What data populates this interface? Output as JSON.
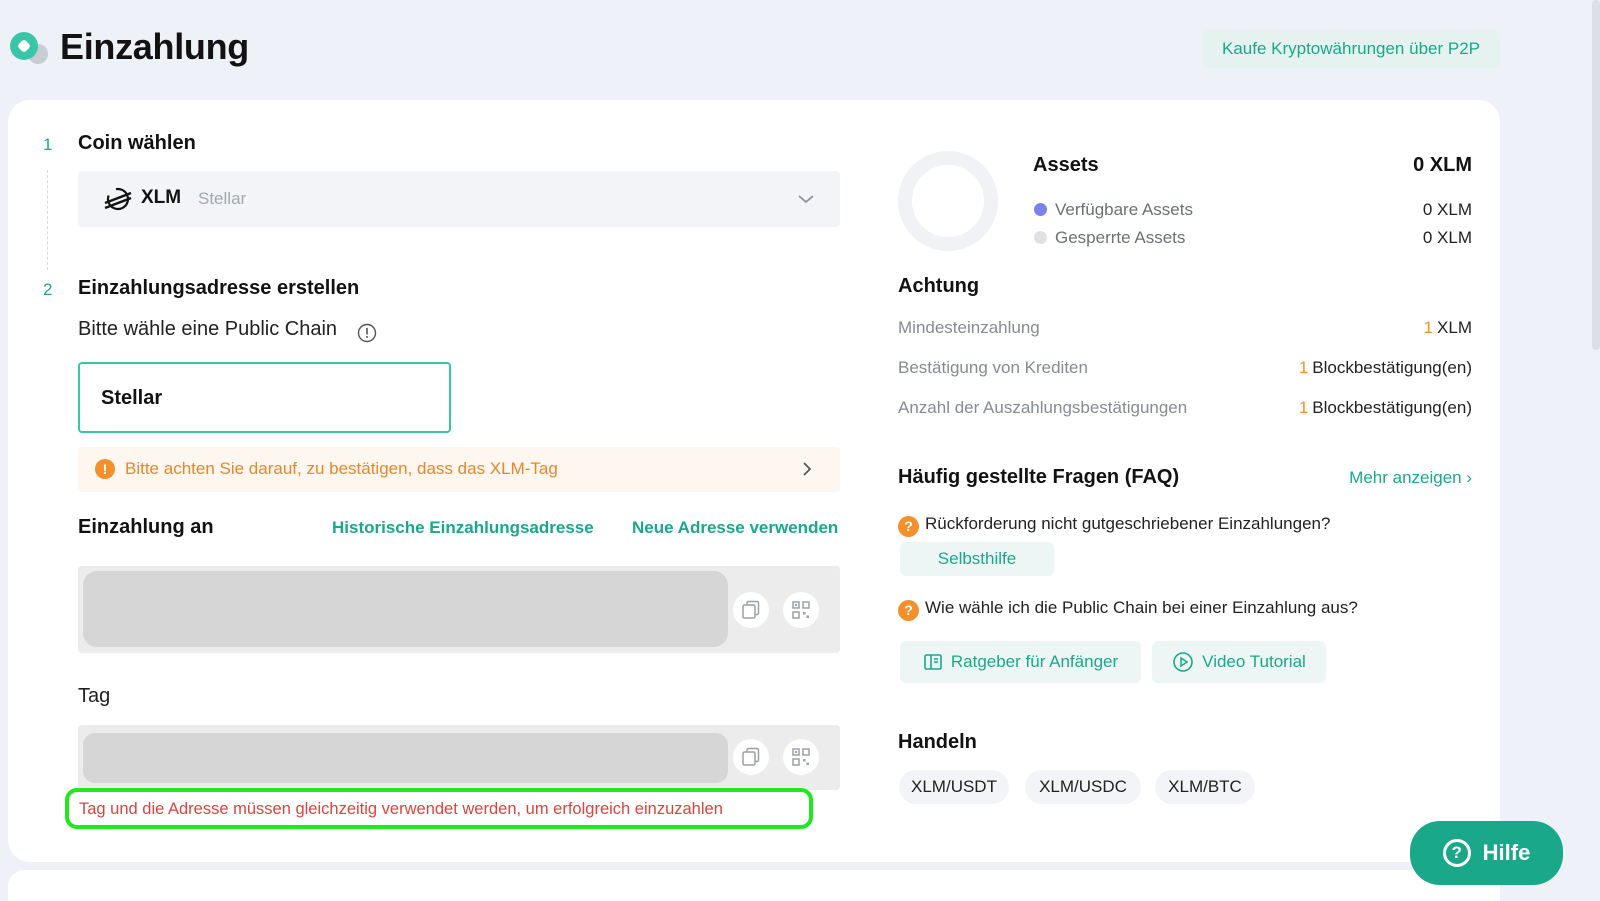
{
  "header": {
    "title": "Einzahlung",
    "p2p_button": "Kaufe Kryptowährungen über P2P"
  },
  "step1": {
    "number": "1",
    "title": "Coin wählen",
    "coin_symbol": "XLM",
    "coin_name": "Stellar",
    "icon": "stellar-icon"
  },
  "step2": {
    "number": "2",
    "title": "Einzahlungsadresse erstellen",
    "chain_label": "Bitte wähle eine Public Chain",
    "chain_selected": "Stellar",
    "notice": "Bitte achten Sie darauf, zu bestätigen, dass das XLM-Tag"
  },
  "deposit": {
    "title": "Einzahlung an",
    "history_link": "Historische Einzahlungsadresse",
    "new_address_link": "Neue Adresse verwenden",
    "tag_label": "Tag",
    "tag_warning": "Tag und die Adresse müssen gleichzeitig verwendet werden, um erfolgreich einzuzahlen"
  },
  "assets": {
    "title": "Assets",
    "total": "0 XLM",
    "available_label": "Verfügbare Assets",
    "available_value": "0 XLM",
    "locked_label": "Gesperrte Assets",
    "locked_value": "0 XLM",
    "available_color": "#7b83eb",
    "locked_color": "#dfe1e6"
  },
  "attention": {
    "title": "Achtung",
    "rows": [
      {
        "label": "Mindesteinzahlung",
        "num": "1",
        "unit": "XLM"
      },
      {
        "label": "Bestätigung von Krediten",
        "num": "1",
        "unit": "Blockbestätigung(en)"
      },
      {
        "label": "Anzahl der Auszahlungsbestätigungen",
        "num": "1",
        "unit": "Blockbestätigung(en)"
      }
    ]
  },
  "faq": {
    "title": "Häufig gestellte Fragen (FAQ)",
    "more": "Mehr anzeigen ›",
    "q1": "Rückforderung nicht gutgeschriebener Einzahlungen?",
    "q1_button": "Selbsthilfe",
    "q2": "Wie wähle ich die Public Chain bei einer Einzahlung aus?",
    "guide_button": "Ratgeber für Anfänger",
    "video_button": "Video Tutorial"
  },
  "trade": {
    "title": "Handeln",
    "pairs": [
      "XLM/USDT",
      "XLM/USDC",
      "XLM/BTC"
    ]
  },
  "help": {
    "label": "Hilfe"
  },
  "colors": {
    "accent": "#1aa88a",
    "warning": "#f3902b",
    "error": "#d9453c",
    "highlight": "#1ee81e"
  }
}
